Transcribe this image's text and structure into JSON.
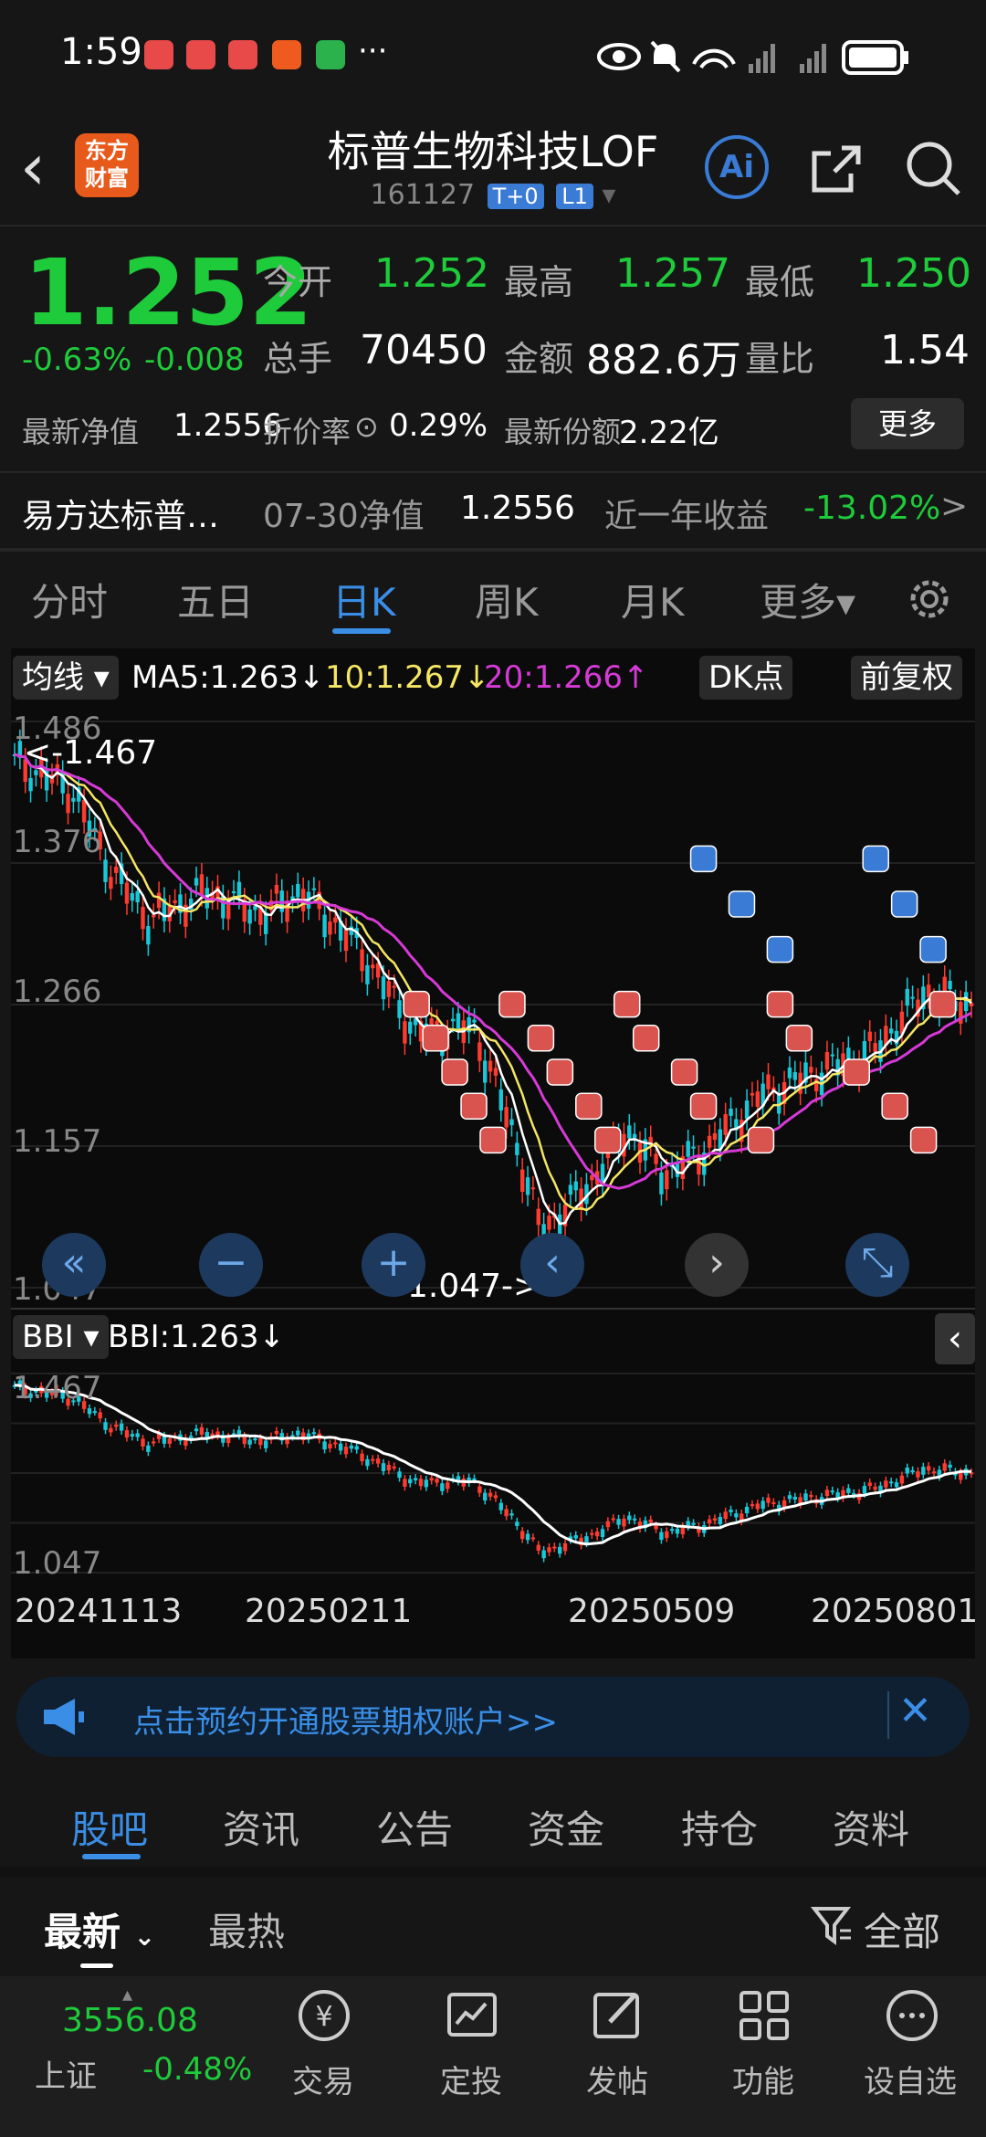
{
  "status": {
    "time": "1:59",
    "extra": "···"
  },
  "header": {
    "logo_text": "东方财富",
    "title": "标普生物科技LOF",
    "code": "161127",
    "tags": [
      "T+0",
      "L1"
    ],
    "ai_label": "Ai"
  },
  "quote": {
    "price": "1.252",
    "change_pct": "-0.63%",
    "change": "-0.008",
    "open_label": "今开",
    "open": "1.252",
    "high_label": "最高",
    "high": "1.257",
    "low_label": "最低",
    "low": "1.250",
    "vol_label": "总手",
    "vol": "70450",
    "amount_label": "金额",
    "amount": "882.6万",
    "ratio_label": "量比",
    "ratio": "1.54",
    "nav_label": "最新净值",
    "nav": "1.2556",
    "discount_label": "折价率",
    "discount": "0.29%",
    "shares_label": "最新份额",
    "shares": "2.22亿",
    "more": "更多"
  },
  "fund": {
    "name": "易方达标普…",
    "date_nav_label": "07-30净值",
    "date_nav": "1.2556",
    "year_label": "近一年收益",
    "year_ret": "-13.02%",
    "arrow": ">"
  },
  "ktabs": [
    "分时",
    "五日",
    "日K",
    "周K",
    "月K",
    "更多▾"
  ],
  "chart": {
    "ma_label": "均线",
    "ma5": "MA5:1.263↓",
    "ma10": "10:1.267↓",
    "ma20": "20:1.266↑",
    "dk": "DK点",
    "fq": "前复权",
    "y_labels": [
      "1.486",
      "1.376",
      "1.266",
      "1.157",
      "1.047"
    ],
    "max_note": "<-1.467",
    "min_note": "1.047->",
    "bbi_label": "BBI",
    "bbi_value": "BBI:1.263↓",
    "bbi_top": "1.467",
    "bbi_bottom": "1.047",
    "dates": [
      "20241113",
      "20250211",
      "20250509",
      "20250801"
    ],
    "colors": {
      "up": "#ff3b30",
      "down": "#19c8d8",
      "ma5": "#ffffff",
      "ma10": "#f5e663",
      "ma20": "#d63ad6"
    }
  },
  "chart_data": {
    "type": "candlestick",
    "ylim": [
      1.047,
      1.486
    ],
    "ma5_last": 1.263,
    "ma10_last": 1.267,
    "ma20_last": 1.266,
    "high": 1.467,
    "low": 1.047,
    "x_ticks": [
      "20241113",
      "20250211",
      "20250509",
      "20250801"
    ]
  },
  "banner": {
    "text": "点击预约开通股票期权账户>>",
    "close": "✕"
  },
  "btabs": [
    "股吧",
    "资讯",
    "公告",
    "资金",
    "持仓",
    "资料"
  ],
  "sort": {
    "latest": "最新",
    "hot": "最热",
    "filter": "全部"
  },
  "nav": {
    "index_value": "3556.08",
    "index_name": "上证",
    "index_change": "-0.48%",
    "items": [
      "交易",
      "定投",
      "发帖",
      "功能",
      "设自选"
    ]
  }
}
